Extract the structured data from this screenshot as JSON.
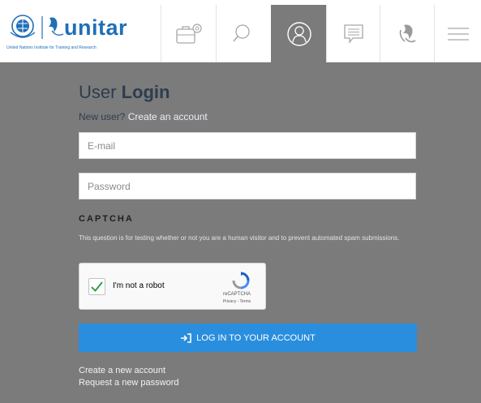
{
  "header": {
    "logo": {
      "brand": "unitar",
      "tagline": "United Nations Institute for Training and Research",
      "brand_color": "#1f6fb8"
    },
    "nav": [
      {
        "name": "briefcase-icon",
        "active": false
      },
      {
        "name": "search-icon",
        "active": false
      },
      {
        "name": "user-icon",
        "active": true
      },
      {
        "name": "chat-icon",
        "active": false
      },
      {
        "name": "globe-icon",
        "active": false
      },
      {
        "name": "menu-icon",
        "active": false
      }
    ]
  },
  "login": {
    "title_plain": "User ",
    "title_bold": "Login",
    "new_user_text": "New user?",
    "create_account_link": "Create an account",
    "email_placeholder": "E-mail",
    "password_placeholder": "Password",
    "captcha_heading": "CAPTCHA",
    "captcha_description": "This question is for testing whether or not you are a human visitor and to prevent automated spam submissions.",
    "recaptcha": {
      "label": "I'm not a robot",
      "checked": true,
      "brand": "reCAPTCHA",
      "links": "Privacy - Terms"
    },
    "submit_label": "LOG IN TO YOUR ACCOUNT",
    "create_new_account_link": "Create a new account",
    "request_password_link": "Request a new password"
  },
  "colors": {
    "page_background": "#7b7b7b",
    "button": "#2a8ede",
    "title_text": "#2d3d4f"
  }
}
